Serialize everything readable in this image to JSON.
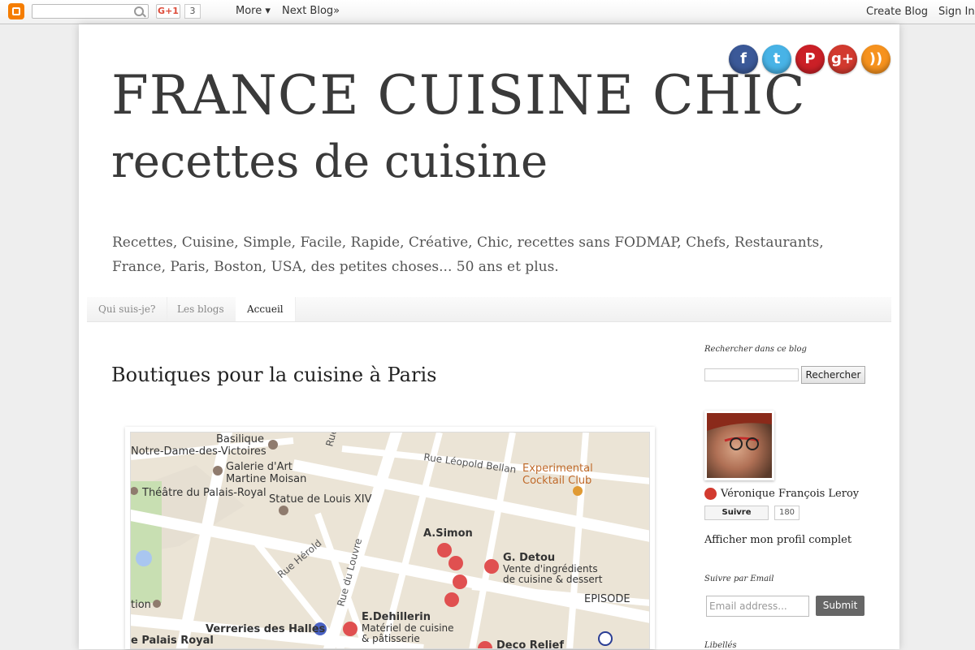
{
  "navbar": {
    "gplus_label": "G+1",
    "gplus_count": "3",
    "more_label": "More ▾",
    "next_blog_label": "Next Blog»",
    "create_blog_label": "Create Blog",
    "sign_in_label": "Sign In"
  },
  "header": {
    "title_line1": "FRANCE CUISINE CHIC",
    "title_line2": "recettes de cuisine",
    "description": "Recettes, Cuisine, Simple, Facile, Rapide, Créative, Chic, recettes sans FODMAP, Chefs, Restaurants, France, Paris, Boston, USA, des petites choses... 50 ans et plus."
  },
  "social": [
    {
      "name": "facebook-icon",
      "glyph": "f",
      "color": "#3b5998"
    },
    {
      "name": "twitter-icon",
      "glyph": "t",
      "color": "#48b3e6"
    },
    {
      "name": "pinterest-icon",
      "glyph": "P",
      "color": "#cb2027"
    },
    {
      "name": "googleplus-icon",
      "glyph": "g+",
      "color": "#d23a2f"
    },
    {
      "name": "rss-icon",
      "glyph": "))",
      "color": "#f6921e"
    }
  ],
  "tabs": [
    {
      "label": "Qui suis-je?"
    },
    {
      "label": "Les blogs"
    },
    {
      "label": "Accueil"
    }
  ],
  "post": {
    "title": "Boutiques pour la cuisine à Paris"
  },
  "map": {
    "labels": [
      "Basilique",
      "Notre-Dame-des-Victoires",
      "Galerie d'Art",
      "Martine Moisan",
      "Théâtre du Palais-Royal",
      "Statue de Louis XIV",
      "Rue Léopold Bellan",
      "Experimental",
      "Cocktail Club",
      "A.Simon",
      "G. Detou",
      "Vente d'ingrédients",
      "de cuisine & dessert",
      "EPISODE",
      "E.Dehillerin",
      "Matériel de cuisine",
      "& pâtisserie",
      "Verreries des Halles",
      "Deco Relief",
      "Rue Hérold",
      "Rue du Louvre",
      "tion",
      "e Palais Royal",
      "Rue d"
    ]
  },
  "sidebar": {
    "search_heading": "Rechercher dans ce blog",
    "search_button": "Rechercher",
    "profile_name": "Véronique François Leroy",
    "follow_label": "Suivre",
    "follow_count": "180",
    "profile_link": "Afficher mon profil complet",
    "email_heading": "Suivre par Email",
    "email_placeholder": "Email address...",
    "submit_label": "Submit",
    "labels_heading": "Libellés"
  }
}
